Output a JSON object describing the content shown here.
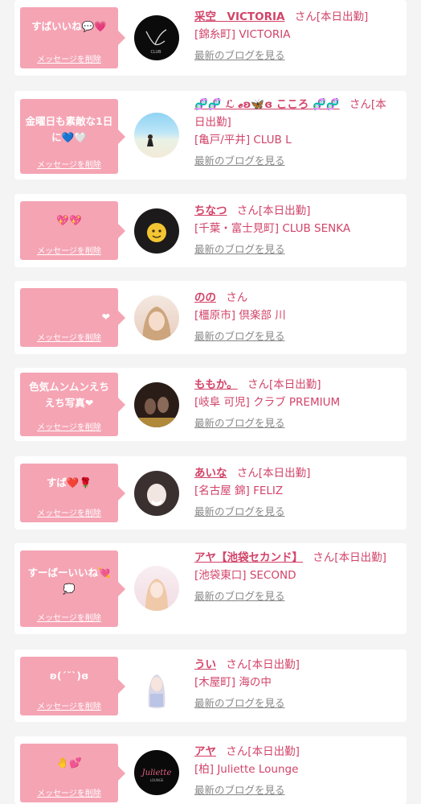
{
  "delete_label": "メッセージを削除",
  "blog_label": "最新のブログを見る",
  "san_label": "さん",
  "items": [
    {
      "message": "すばいいね💬💗",
      "name": "采空　VICTORIA",
      "status": "[本日出勤]",
      "location": "[錦糸町] VICTORIA"
    },
    {
      "message": "金曜日も素敵な1日に💙🤍",
      "name": "🧬🧬 ℒ 𝓮ʚ🦋ɞ こころ 🧬🧬",
      "status": "[本日出勤]",
      "location": "[亀戸/平井] CLUB L"
    },
    {
      "message": "💖💖",
      "name": "ちなつ",
      "status": "[本日出勤]",
      "location": "[千葉・富士見町] CLUB SENKA"
    },
    {
      "message": "❤",
      "name": "のの",
      "status": "",
      "location": "[橿原市] 倶楽部 川"
    },
    {
      "message": "色気ムンムンえちえち写真❤",
      "name": "ももか。",
      "status": "[本日出勤]",
      "location": "[岐阜 可児] クラブ PREMIUM"
    },
    {
      "message": "すば❤️🌹",
      "name": "あいな",
      "status": "[本日出勤]",
      "location": "[名古屋 錦] FELIZ"
    },
    {
      "message": "すーばーいいね💘💭",
      "name": "アヤ【池袋セカンド】",
      "status": "[本日出勤]",
      "location": "[池袋東口] SECOND"
    },
    {
      "message": "ʚ(´˘`)ɞ",
      "name": "うい",
      "status": "[本日出勤]",
      "location": "[木屋町] 海の中"
    },
    {
      "message": "🤚💕",
      "name": "アヤ",
      "status": "[本日出勤]",
      "location": "[柏] Juliette Lounge"
    }
  ]
}
